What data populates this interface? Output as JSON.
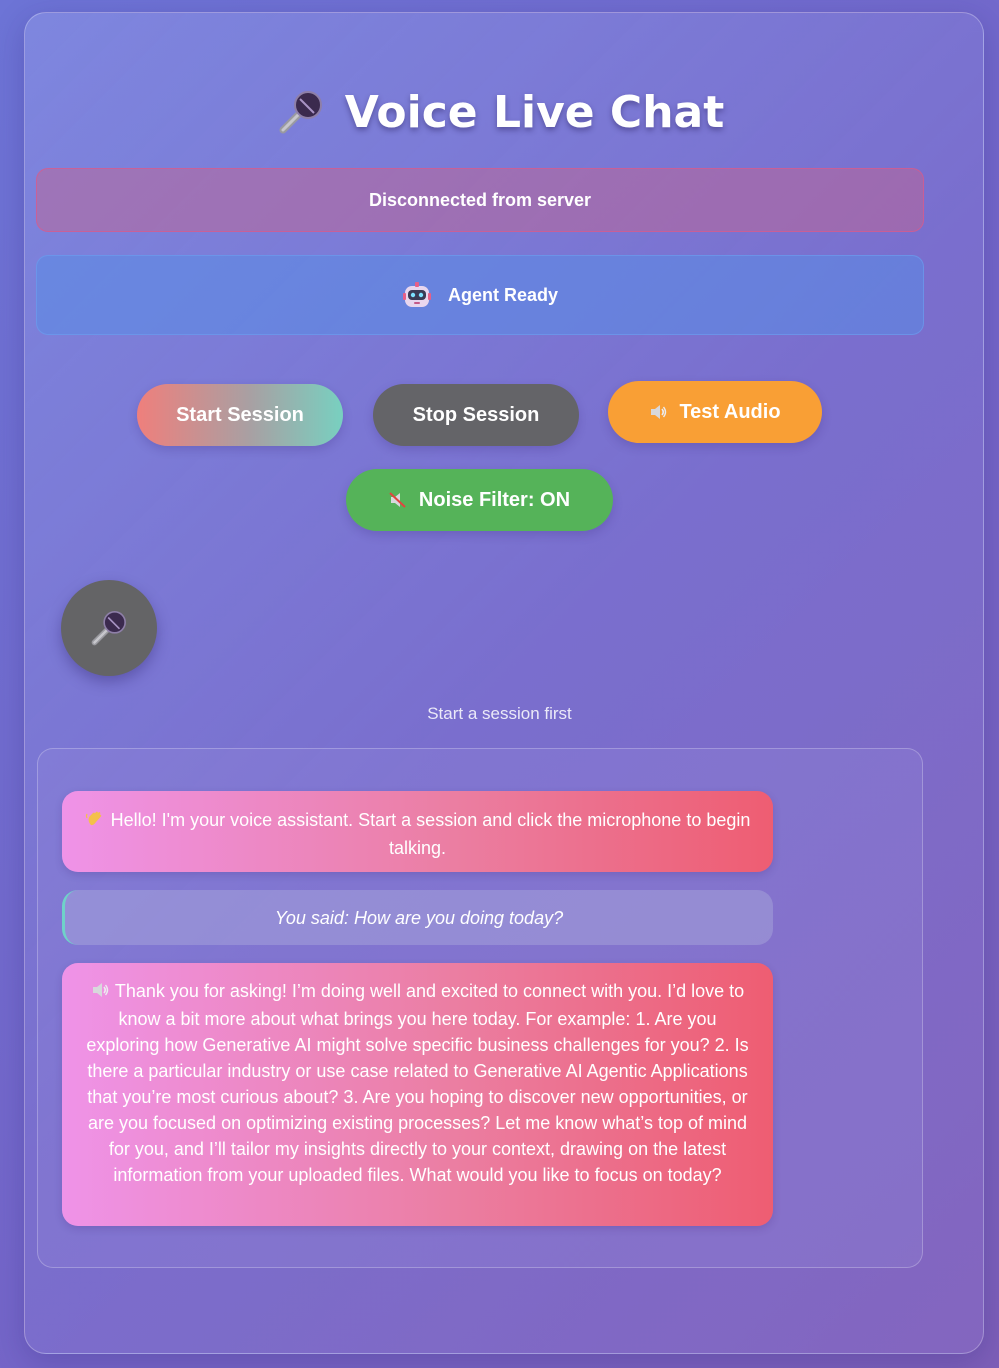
{
  "header": {
    "title": "Voice Live Chat",
    "icon": "microphone-icon"
  },
  "status": {
    "connection": "Disconnected from server",
    "agent": "Agent Ready",
    "agent_icon": "robot-icon"
  },
  "controls": {
    "start_label": "Start Session",
    "stop_label": "Stop Session",
    "test_label": "Test Audio",
    "noise_label": "Noise Filter: ON"
  },
  "mic": {
    "hint": "Start a session first"
  },
  "messages": [
    {
      "role": "assistant",
      "icon": "waving-hand-icon",
      "text": "Hello! I'm your voice assistant. Start a session and click the microphone to begin talking."
    },
    {
      "role": "user",
      "text": "You said: How are you doing today?"
    },
    {
      "role": "assistant",
      "icon": "speaker-icon",
      "text": "Thank you for asking! I’m doing well and excited to connect with you. I’d love to know a bit more about what brings you here today. For example: 1. Are you exploring how Generative AI might solve specific business challenges for you? 2. Is there a particular industry or use case related to Generative AI Agentic Applications that you’re most curious about? 3. Are you hoping to discover new opportunities, or are you focused on optimizing existing processes? Let me know what’s top of mind for you, and I’ll tailor my insights directly to your context, drawing on the latest information from your uploaded files. What would you like to focus on today?"
    }
  ],
  "colors": {
    "start": "#ef7f7c",
    "stop": "#646468",
    "test": "#f99f35",
    "noise": "#55b359",
    "bubble": "#ee5d72"
  }
}
